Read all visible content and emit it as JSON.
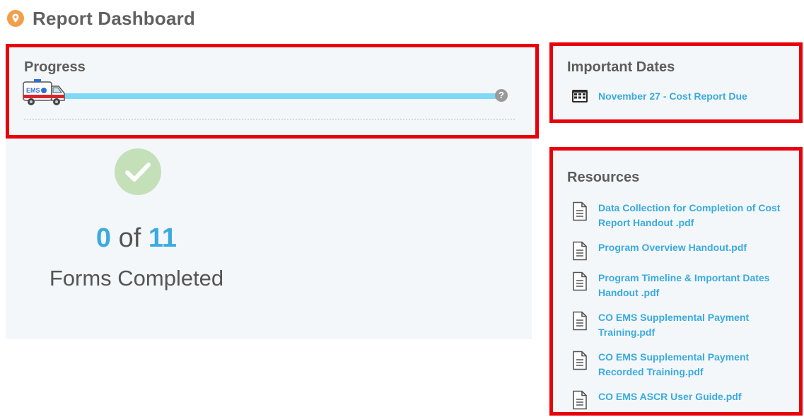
{
  "header": {
    "title": "Report Dashboard",
    "icon": "location-pin-icon",
    "icon_color": "#f0a04b"
  },
  "progress": {
    "title": "Progress",
    "help_glyph": "?",
    "track_color": "#7fd8f6",
    "ambulance_label": "EMS"
  },
  "summary": {
    "completed": "0",
    "of_text": "of",
    "total": "11",
    "label": "Forms Completed",
    "accent": "#3aaae0"
  },
  "important_dates": {
    "title": "Important Dates",
    "items": [
      {
        "label": "November 27 - Cost Report Due",
        "icon": "calendar-icon"
      }
    ]
  },
  "resources": {
    "title": "Resources",
    "items": [
      {
        "label": "Data Collection for Completion of Cost Report Handout .pdf",
        "icon": "document-icon"
      },
      {
        "label": "Program Overview Handout.pdf",
        "icon": "document-icon"
      },
      {
        "label": "Program Timeline & Important Dates Handout .pdf",
        "icon": "document-icon"
      },
      {
        "label": "CO EMS Supplemental Payment Training.pdf",
        "icon": "document-icon"
      },
      {
        "label": "CO EMS Supplemental Payment Recorded Training.pdf",
        "icon": "document-icon"
      },
      {
        "label": "CO EMS ASCR User Guide.pdf",
        "icon": "document-icon"
      }
    ]
  },
  "colors": {
    "highlight_box": "#e8000b",
    "panel_bg": "#f3f7f9",
    "link": "#3aaae0"
  }
}
